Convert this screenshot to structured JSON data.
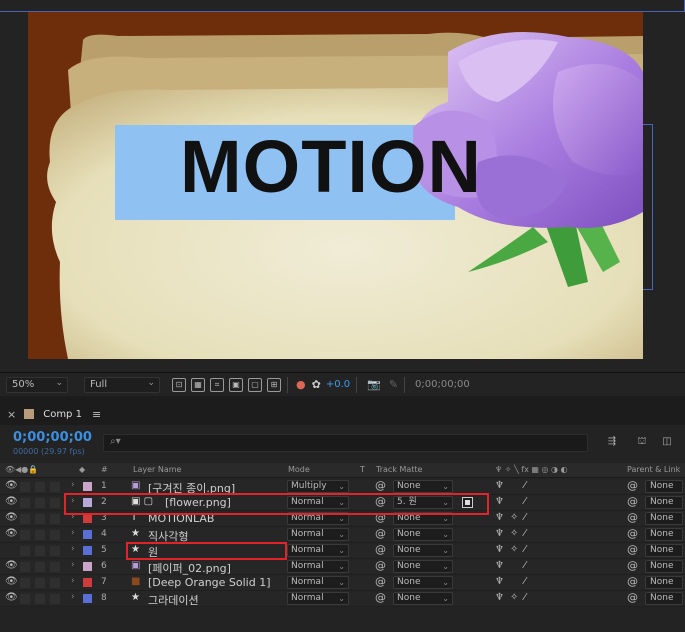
{
  "viewer": {
    "canvas_text": "MOTION",
    "zoom": "50%",
    "resolution": "Full",
    "exposure": "+0.0",
    "timecode": "0;00;00;00"
  },
  "comp_panel": {
    "tab_label": "Comp 1",
    "timecode": "0;00;00;00",
    "fps": "00000 (29.97 fps)",
    "columns": {
      "number": "#",
      "layer_name": "Layer Name",
      "mode": "Mode",
      "t": "T",
      "track_matte": "Track Matte",
      "parent_link": "Parent & Link"
    },
    "layers": [
      {
        "num": "1",
        "name": "[구겨진 종이.png]",
        "mode": "Multiply",
        "matte": "None",
        "parent": "None",
        "label_color": "#c9a6c9",
        "type_icon": "image-icon",
        "visible": true
      },
      {
        "num": "2",
        "name": "[flower.png]",
        "mode": "Normal",
        "matte": "5. 원",
        "parent": "None",
        "label_color": "#b9a9d9",
        "type_icon": "image-icon",
        "visible": true
      },
      {
        "num": "3",
        "name": "MOTIONLAB",
        "mode": "Normal",
        "matte": "None",
        "parent": "None",
        "label_color": "#d23b3b",
        "type_icon": "text-icon",
        "visible": true
      },
      {
        "num": "4",
        "name": "직사각형",
        "mode": "Normal",
        "matte": "None",
        "parent": "None",
        "label_color": "#5a6fd6",
        "type_icon": "shape-icon",
        "visible": true
      },
      {
        "num": "5",
        "name": "원",
        "mode": "Normal",
        "matte": "None",
        "parent": "None",
        "label_color": "#5a6fd6",
        "type_icon": "shape-icon",
        "visible": false
      },
      {
        "num": "6",
        "name": "[페이퍼_02.png]",
        "mode": "Normal",
        "matte": "None",
        "parent": "None",
        "label_color": "#c9a6c9",
        "type_icon": "image-icon",
        "visible": true
      },
      {
        "num": "7",
        "name": "[Deep Orange Solid 1]",
        "mode": "Normal",
        "matte": "None",
        "parent": "None",
        "label_color": "#d23b3b",
        "type_icon": "solid-icon",
        "visible": true
      },
      {
        "num": "8",
        "name": "그라데이션",
        "mode": "Normal",
        "matte": "None",
        "parent": "None",
        "label_color": "#5a6fd6",
        "type_icon": "shape-icon",
        "visible": true
      }
    ]
  }
}
